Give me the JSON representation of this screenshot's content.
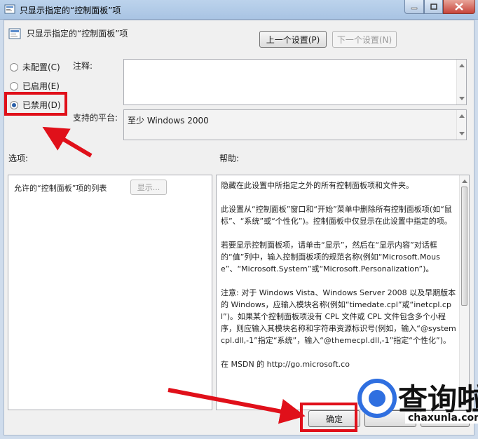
{
  "window": {
    "title": "只显示指定的“控制面板”项"
  },
  "header": {
    "title": "只显示指定的“控制面板”项",
    "prev_label": "上一个设置(P)",
    "next_label": "下一个设置(N)"
  },
  "radios": [
    {
      "label": "未配置(C)",
      "checked": false
    },
    {
      "label": "已启用(E)",
      "checked": false
    },
    {
      "label": "已禁用(D)",
      "checked": true
    }
  ],
  "labels": {
    "comment": "注释:",
    "platform": "支持的平台:",
    "options": "选项:",
    "help": "帮助:"
  },
  "platform_value": "至少 Windows 2000",
  "options": {
    "item_label": "允许的“控制面板”项的列表",
    "show_label": "显示..."
  },
  "help": {
    "p1": "隐藏在此设置中所指定之外的所有控制面板项和文件夹。",
    "p2": "此设置从“控制面板”窗口和“开始”菜单中删除所有控制面板项(如“鼠标”、“系统”或“个性化”)。控制面板中仅显示在此设置中指定的项。",
    "p3": "若要显示控制面板项，请单击“显示”，然后在“显示内容”对话框的“值”列中，输入控制面板项的规范名称(例如“Microsoft.Mouse”、“Microsoft.System”或“Microsoft.Personalization”)。",
    "p4": "注意: 对于 Windows Vista、Windows Server 2008 以及早期版本的 Windows，应输入模块名称(例如“timedate.cpl”或“inetcpl.cpl”)。如果某个控制面板项没有 CPL 文件或 CPL 文件包含多个小程序，则应输入其模块名称和字符串资源标识号(例如，输入“@systemcpl.dll,-1”指定“系统”，输入“@themecpl.dll,-1”指定“个性化”)。",
    "p5": "在 MSDN 的 http://go.microsoft.co"
  },
  "footer": {
    "ok_label": "确定"
  },
  "watermark": {
    "name": "查询啦",
    "domain": "chaxunla.com"
  },
  "colors": {
    "annotation": "#e0101a",
    "watermark_blue": "#2f6fe0"
  }
}
